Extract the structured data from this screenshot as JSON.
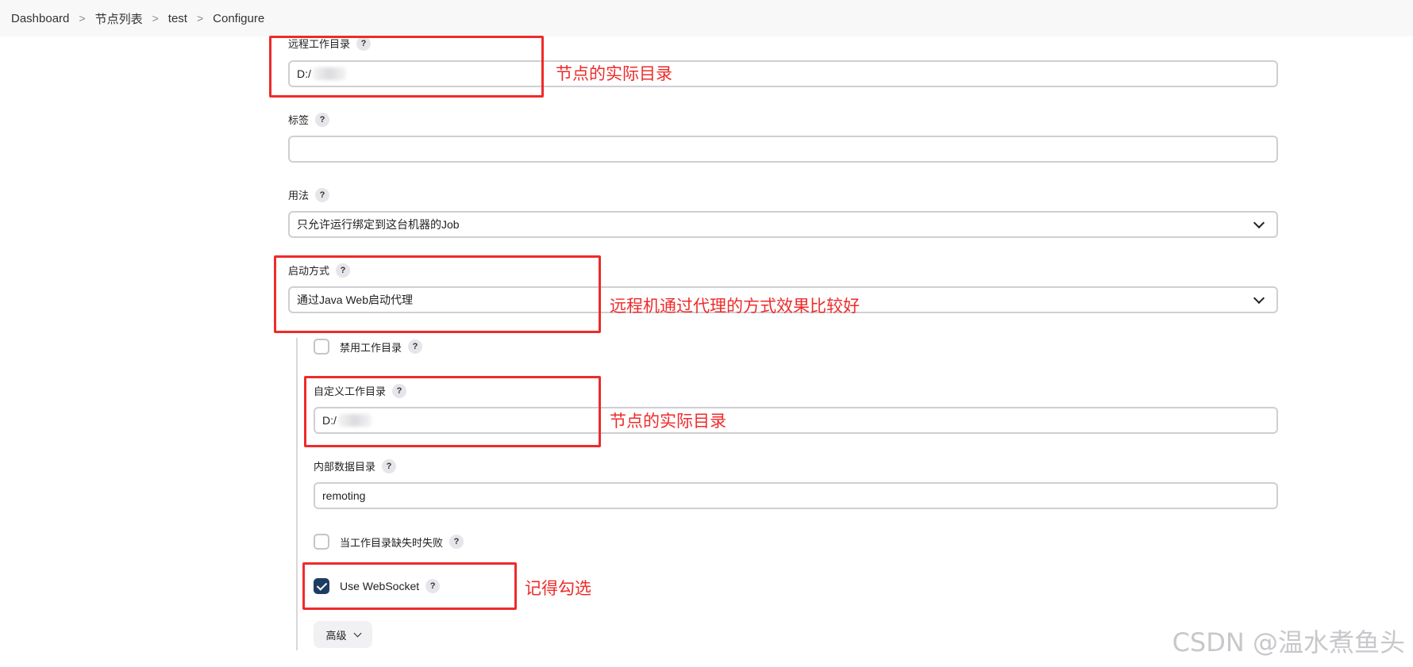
{
  "breadcrumb": {
    "items": [
      "Dashboard",
      "节点列表",
      "test",
      "Configure"
    ],
    "separator": ">"
  },
  "form": {
    "remote_dir": {
      "label": "远程工作目录",
      "value": "D:/"
    },
    "labels": {
      "label": "标签",
      "value": ""
    },
    "usage": {
      "label": "用法",
      "selected": "只允许运行绑定到这台机器的Job"
    },
    "launch": {
      "label": "启动方式",
      "selected": "通过Java Web启动代理"
    },
    "disable_workdir": {
      "label": "禁用工作目录",
      "checked": false
    },
    "custom_workdir": {
      "label": "自定义工作目录",
      "value": "D:/"
    },
    "internal_dir": {
      "label": "内部数据目录",
      "value": "remoting"
    },
    "fail_if_missing": {
      "label": "当工作目录缺失时失败",
      "checked": false
    },
    "websocket": {
      "label": "Use WebSocket",
      "checked": true
    },
    "advanced": {
      "label": "高级"
    },
    "help_glyph": "?"
  },
  "annotations": {
    "remote_dir_note": "节点的实际目录",
    "launch_note": "远程机通过代理的方式效果比较好",
    "custom_dir_note": "节点的实际目录",
    "websocket_note": "记得勾选"
  },
  "watermark": "CSDN @温水煮鱼头",
  "colors": {
    "annotation_red": "#ee2b2b",
    "checkbox_checked": "#1d3c63"
  }
}
